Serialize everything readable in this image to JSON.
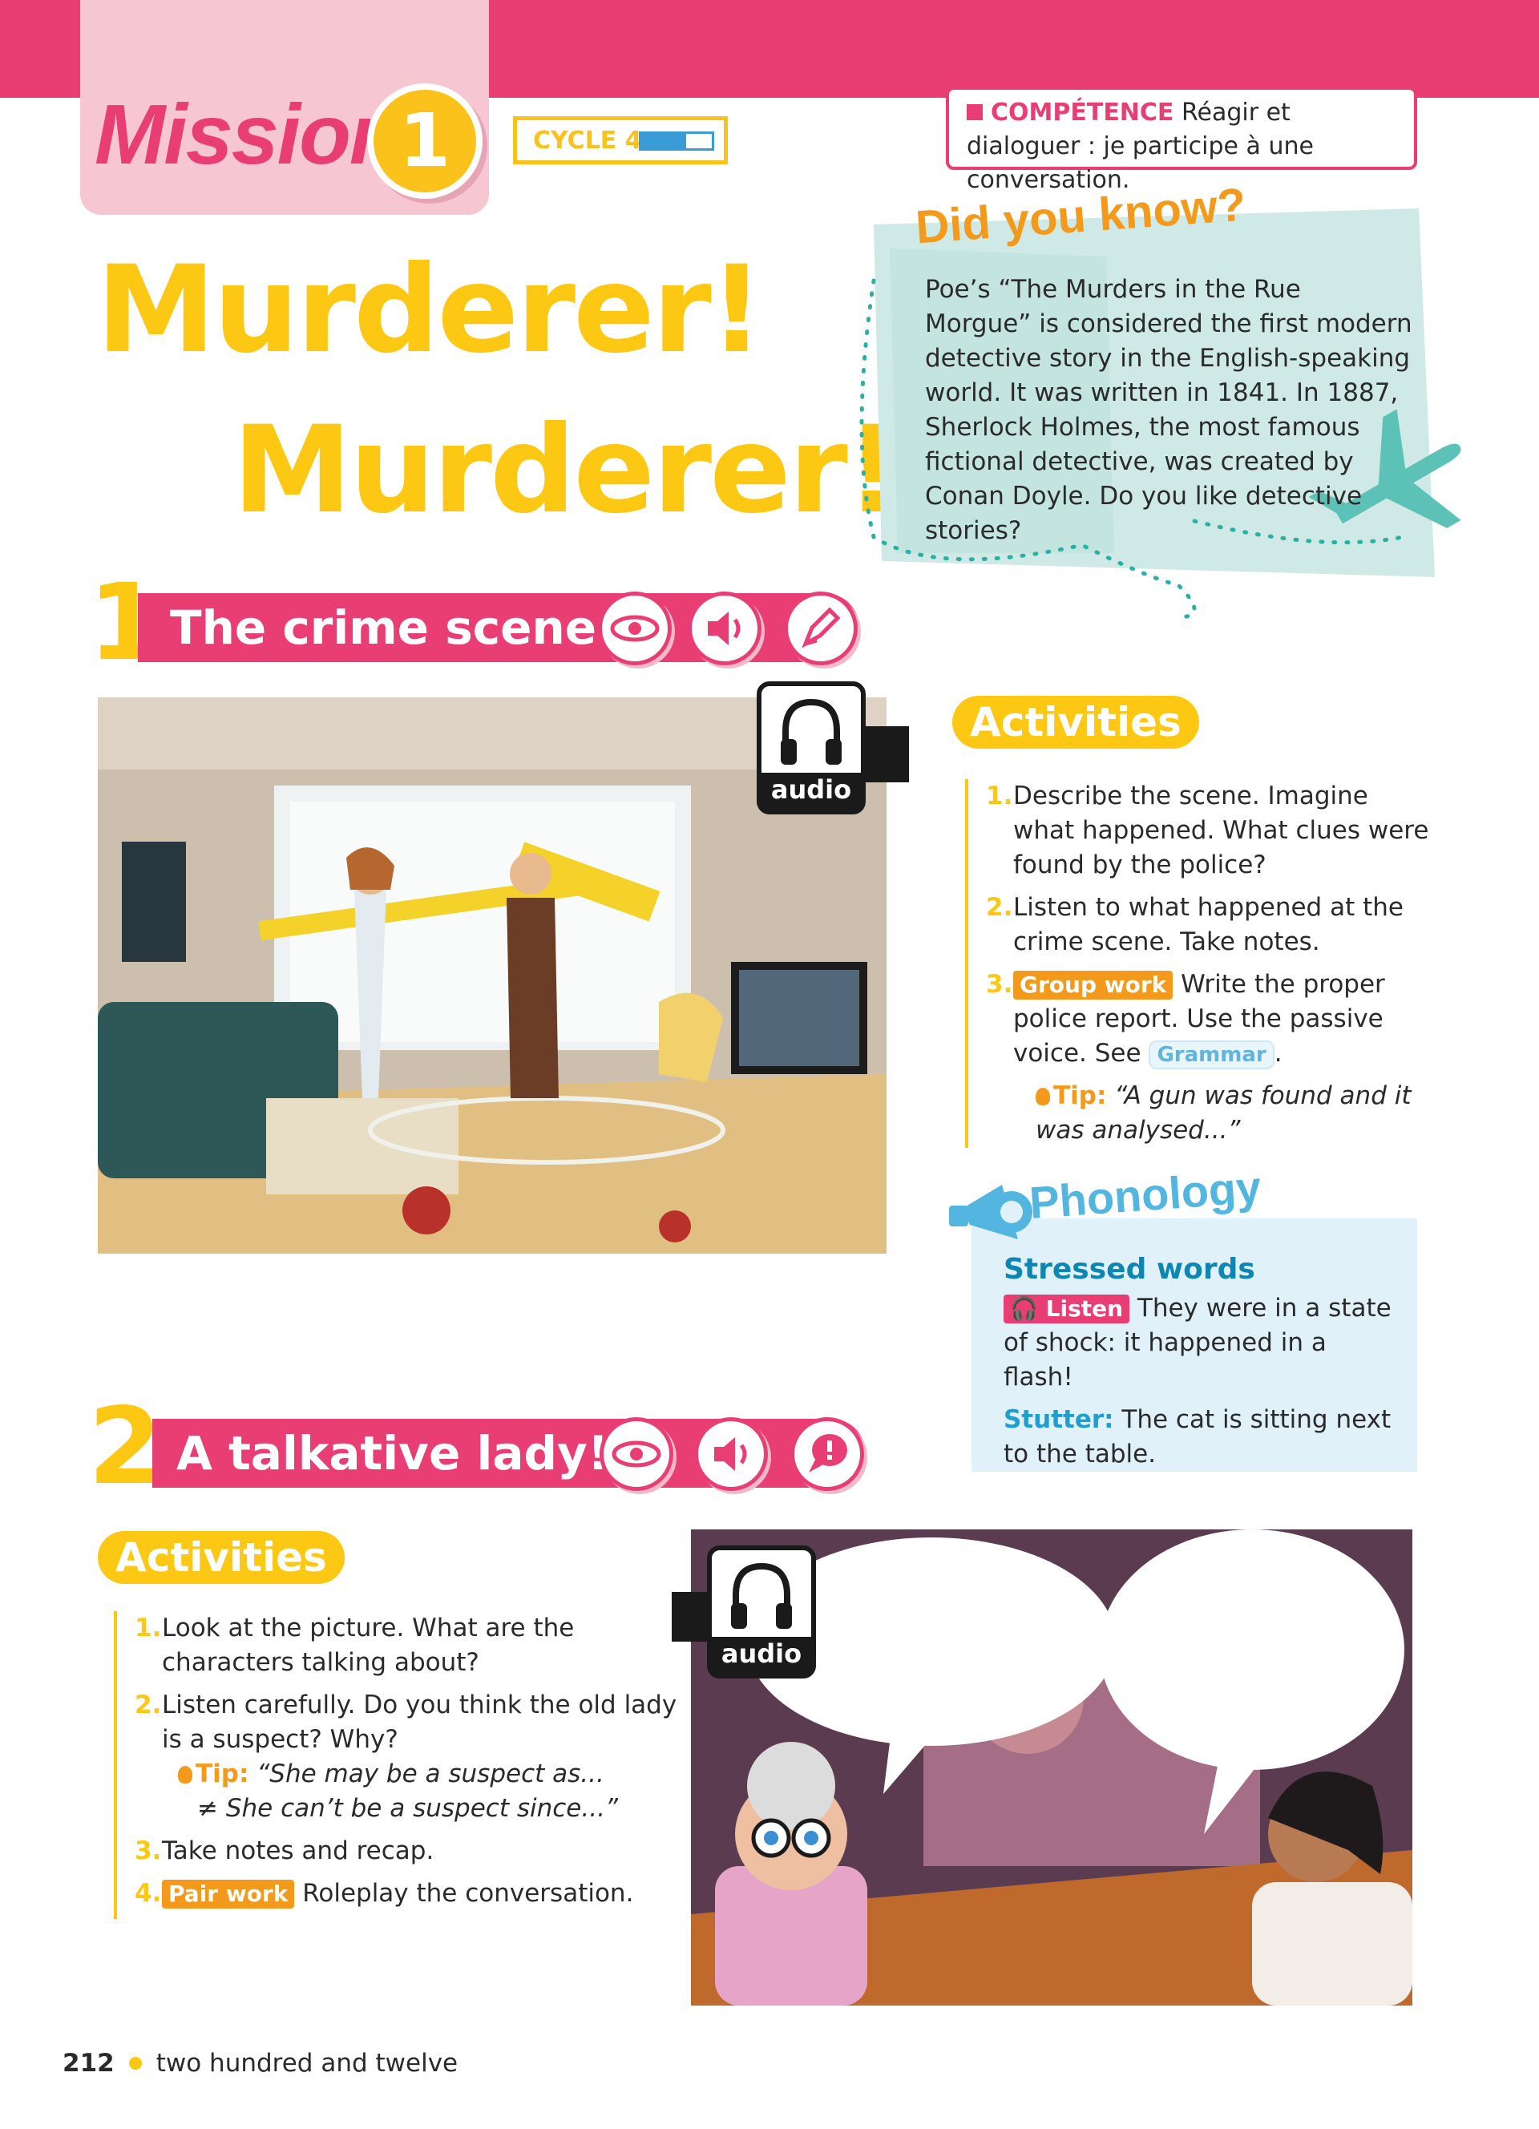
{
  "header": {
    "mission_label": "Mission",
    "mission_number": "1",
    "cycle_label": "CYCLE 4",
    "cycle_progress": 0.6,
    "competence_label": "COMPÉTENCE",
    "competence_text": "Réagir et dialoguer : je participe à une conversation."
  },
  "title": {
    "line1": "Murderer!",
    "line2": "Murderer!"
  },
  "did_you_know": {
    "heading": "Did you know?",
    "text": "Poe’s “The Murders in the Rue Morgue” is considered the first modern detective story in the English-speaking world. It was written in 1841. In 1887, Sherlock Holmes, the most famous fictional detective, was created by Conan Doyle. Do you like detective stories?"
  },
  "section1": {
    "number": "1",
    "title": "The crime scene",
    "icons": [
      "eye-icon",
      "speaker-icon",
      "pen-icon"
    ],
    "audio_label": "audio",
    "activities_heading": "Activities",
    "activities": [
      {
        "num": "1.",
        "text": "Describe the scene. Imagine what happened. What clues were found by the police?"
      },
      {
        "num": "2.",
        "text": "Listen to what happened at the crime scene. Take notes."
      },
      {
        "num": "3.",
        "tag": "Group work",
        "text": "Write the proper police report. Use the passive voice. See",
        "link": "Grammar",
        "after": "."
      }
    ],
    "tip_label": "Tip:",
    "tip_text": "“A gun was found and it was analysed...”"
  },
  "phonology": {
    "heading": "Phonology",
    "subheading": "Stressed words",
    "listen_tag": "Listen",
    "listen_text": "They were in a state of shock: it happened in a flash!",
    "stutter_label": "Stutter:",
    "stutter_text": "The cat is sitting next to the table."
  },
  "section2": {
    "number": "2",
    "title": "A talkative lady!",
    "icons": [
      "eye-icon",
      "speaker-icon",
      "speech-bubble-icon"
    ],
    "audio_label": "audio",
    "activities_heading": "Activities",
    "activities": [
      {
        "num": "1.",
        "text": "Look at the picture. What are the characters talking about?"
      },
      {
        "num": "2.",
        "text": "Listen carefully. Do you think the old lady is a suspect? Why?"
      },
      {
        "num": "3.",
        "text": "Take notes and recap."
      },
      {
        "num": "4.",
        "tag": "Pair work",
        "text": "Roleplay the conversation."
      }
    ],
    "tip_label": "Tip:",
    "tip_line1": "“She may be a suspect as...",
    "tip_line2": "≠ She can’t be a suspect since...”"
  },
  "footer": {
    "page_number": "212",
    "page_words": "two hundred and twelve"
  },
  "colors": {
    "pink": "#e83e74",
    "yellow": "#fcc813",
    "orange": "#f39a1c",
    "teal": "#cfe9e6",
    "blue": "#52b6e0"
  }
}
